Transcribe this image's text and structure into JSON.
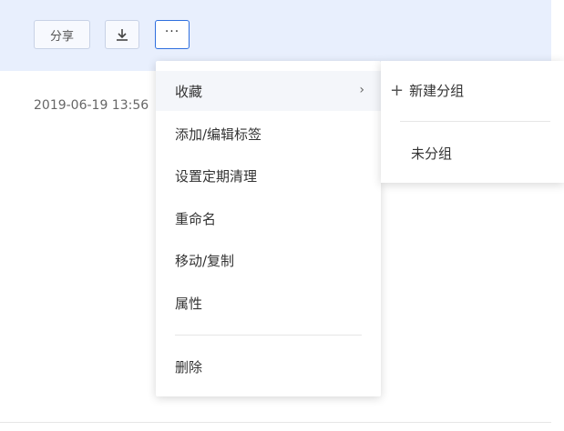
{
  "toolbar": {
    "share_label": "分享",
    "download_icon": "download-icon",
    "more_icon": "more-icon",
    "more_label": "···"
  },
  "file": {
    "timestamp": "2019-06-19 13:56"
  },
  "menu": {
    "items": [
      {
        "label": "收藏",
        "has_submenu": true
      },
      {
        "label": "添加/编辑标签"
      },
      {
        "label": "设置定期清理"
      },
      {
        "label": "重命名"
      },
      {
        "label": "移动/复制"
      },
      {
        "label": "属性"
      },
      {
        "label": "删除"
      }
    ],
    "submenu_chevron": "›"
  },
  "submenu": {
    "new_group_label": "新建分组",
    "plus_icon": "+",
    "ungrouped_label": "未分组"
  },
  "colors": {
    "toolbar_bg": "#e8effd",
    "accent_border": "#2f6fde"
  }
}
